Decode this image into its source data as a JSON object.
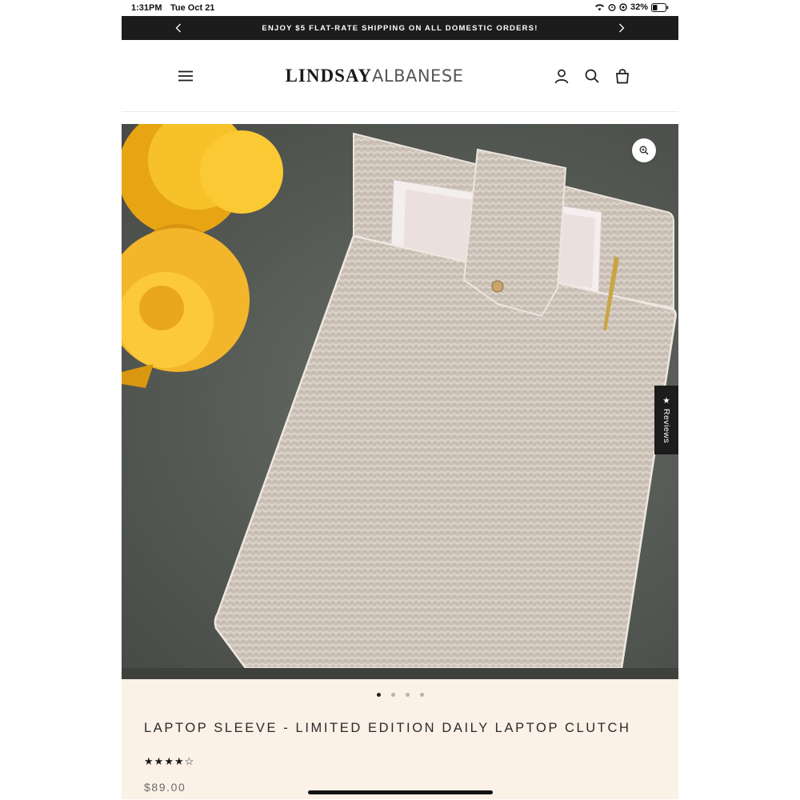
{
  "status_bar": {
    "time": "1:31PM",
    "date": "Tue Oct 21",
    "battery": "32%"
  },
  "announcement": {
    "text": "ENJOY $5 FLAT-RATE SHIPPING ON ALL DOMESTIC ORDERS!"
  },
  "header": {
    "logo_bold": "LINDSAY",
    "logo_thin": "ALBANESE"
  },
  "gallery": {
    "reviews_tab": "★ Reviews",
    "dots_total": 4,
    "active_dot": 1
  },
  "product": {
    "title": "LAPTOP SLEEVE - LIMITED EDITION DAILY LAPTOP CLUTCH",
    "rating": 4,
    "rating_max": 5,
    "price": "$89.00"
  },
  "colors": {
    "announcement_bg": "#1c1c1c",
    "info_bg": "#fbf1e7",
    "sleeve": "#cfc6bd"
  }
}
